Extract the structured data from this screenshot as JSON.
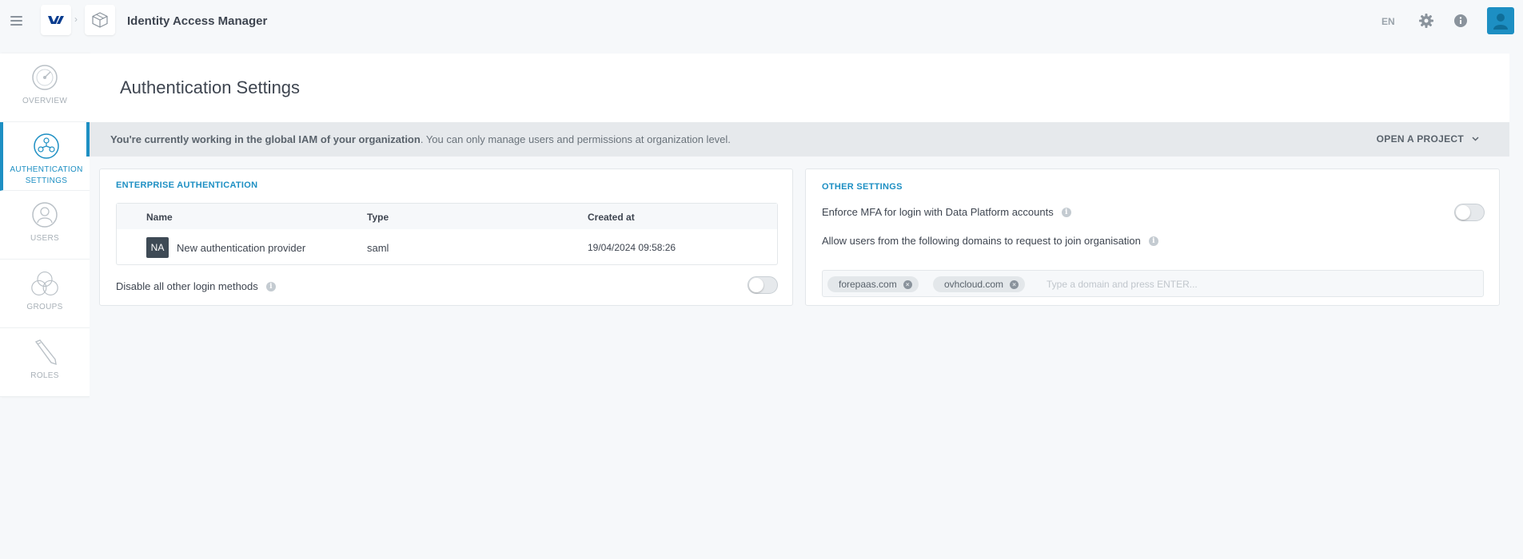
{
  "topbar": {
    "app_title": "Identity Access Manager",
    "breadcrumb_separator": "›",
    "language": "EN"
  },
  "sidebar": {
    "items": [
      {
        "label": "OVERVIEW",
        "icon": "gauge-icon"
      },
      {
        "label_line1": "AUTHENTICATION",
        "label_line2": "SETTINGS",
        "icon": "network-globe-icon",
        "active": true
      },
      {
        "label": "USERS",
        "icon": "user-circle-icon"
      },
      {
        "label": "GROUPS",
        "icon": "group-circles-icon"
      },
      {
        "label": "ROLES",
        "icon": "pencil-icon"
      }
    ]
  },
  "page": {
    "title": "Authentication Settings"
  },
  "notice": {
    "bold_text": "You're currently working in the global IAM of your organization",
    "text": ". You can only manage users and permissions at organization level.",
    "open_project_label": "OPEN A PROJECT"
  },
  "enterprise_auth": {
    "section_title": "ENTERPRISE AUTHENTICATION",
    "columns": [
      "Name",
      "Type",
      "Created at"
    ],
    "rows": [
      {
        "initials": "NA",
        "name": "New authentication provider",
        "type": "saml",
        "created_at": "19/04/2024 09:58:26"
      }
    ],
    "disable_other_label": "Disable all other login methods",
    "disable_other_enabled": false
  },
  "other_settings": {
    "section_title": "OTHER SETTINGS",
    "enforce_mfa_label": "Enforce MFA for login with Data Platform accounts",
    "enforce_mfa_enabled": false,
    "allow_domains_label": "Allow users from the following domains to request to join organisation",
    "domains": [
      "forepaas.com",
      "ovhcloud.com"
    ],
    "domain_placeholder": "Type a domain and press ENTER..."
  },
  "colors": {
    "accent": "#1d8fc3",
    "text": "#3e4550",
    "muted": "#a8b0b7",
    "notice_bg": "#e6e9ec"
  }
}
